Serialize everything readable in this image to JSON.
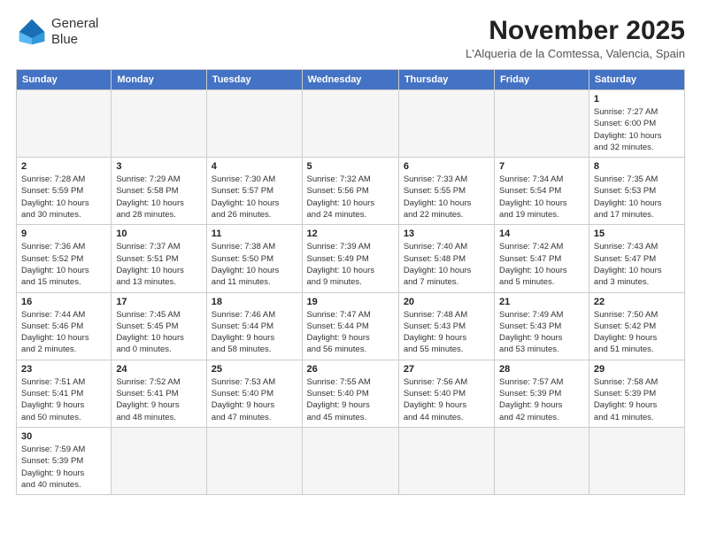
{
  "logo": {
    "line1": "General",
    "line2": "Blue"
  },
  "title": "November 2025",
  "location": "L'Alqueria de la Comtessa, Valencia, Spain",
  "weekdays": [
    "Sunday",
    "Monday",
    "Tuesday",
    "Wednesday",
    "Thursday",
    "Friday",
    "Saturday"
  ],
  "weeks": [
    [
      {
        "day": "",
        "info": ""
      },
      {
        "day": "",
        "info": ""
      },
      {
        "day": "",
        "info": ""
      },
      {
        "day": "",
        "info": ""
      },
      {
        "day": "",
        "info": ""
      },
      {
        "day": "",
        "info": ""
      },
      {
        "day": "1",
        "info": "Sunrise: 7:27 AM\nSunset: 6:00 PM\nDaylight: 10 hours\nand 32 minutes."
      }
    ],
    [
      {
        "day": "2",
        "info": "Sunrise: 7:28 AM\nSunset: 5:59 PM\nDaylight: 10 hours\nand 30 minutes."
      },
      {
        "day": "3",
        "info": "Sunrise: 7:29 AM\nSunset: 5:58 PM\nDaylight: 10 hours\nand 28 minutes."
      },
      {
        "day": "4",
        "info": "Sunrise: 7:30 AM\nSunset: 5:57 PM\nDaylight: 10 hours\nand 26 minutes."
      },
      {
        "day": "5",
        "info": "Sunrise: 7:32 AM\nSunset: 5:56 PM\nDaylight: 10 hours\nand 24 minutes."
      },
      {
        "day": "6",
        "info": "Sunrise: 7:33 AM\nSunset: 5:55 PM\nDaylight: 10 hours\nand 22 minutes."
      },
      {
        "day": "7",
        "info": "Sunrise: 7:34 AM\nSunset: 5:54 PM\nDaylight: 10 hours\nand 19 minutes."
      },
      {
        "day": "8",
        "info": "Sunrise: 7:35 AM\nSunset: 5:53 PM\nDaylight: 10 hours\nand 17 minutes."
      }
    ],
    [
      {
        "day": "9",
        "info": "Sunrise: 7:36 AM\nSunset: 5:52 PM\nDaylight: 10 hours\nand 15 minutes."
      },
      {
        "day": "10",
        "info": "Sunrise: 7:37 AM\nSunset: 5:51 PM\nDaylight: 10 hours\nand 13 minutes."
      },
      {
        "day": "11",
        "info": "Sunrise: 7:38 AM\nSunset: 5:50 PM\nDaylight: 10 hours\nand 11 minutes."
      },
      {
        "day": "12",
        "info": "Sunrise: 7:39 AM\nSunset: 5:49 PM\nDaylight: 10 hours\nand 9 minutes."
      },
      {
        "day": "13",
        "info": "Sunrise: 7:40 AM\nSunset: 5:48 PM\nDaylight: 10 hours\nand 7 minutes."
      },
      {
        "day": "14",
        "info": "Sunrise: 7:42 AM\nSunset: 5:47 PM\nDaylight: 10 hours\nand 5 minutes."
      },
      {
        "day": "15",
        "info": "Sunrise: 7:43 AM\nSunset: 5:47 PM\nDaylight: 10 hours\nand 3 minutes."
      }
    ],
    [
      {
        "day": "16",
        "info": "Sunrise: 7:44 AM\nSunset: 5:46 PM\nDaylight: 10 hours\nand 2 minutes."
      },
      {
        "day": "17",
        "info": "Sunrise: 7:45 AM\nSunset: 5:45 PM\nDaylight: 10 hours\nand 0 minutes."
      },
      {
        "day": "18",
        "info": "Sunrise: 7:46 AM\nSunset: 5:44 PM\nDaylight: 9 hours\nand 58 minutes."
      },
      {
        "day": "19",
        "info": "Sunrise: 7:47 AM\nSunset: 5:44 PM\nDaylight: 9 hours\nand 56 minutes."
      },
      {
        "day": "20",
        "info": "Sunrise: 7:48 AM\nSunset: 5:43 PM\nDaylight: 9 hours\nand 55 minutes."
      },
      {
        "day": "21",
        "info": "Sunrise: 7:49 AM\nSunset: 5:43 PM\nDaylight: 9 hours\nand 53 minutes."
      },
      {
        "day": "22",
        "info": "Sunrise: 7:50 AM\nSunset: 5:42 PM\nDaylight: 9 hours\nand 51 minutes."
      }
    ],
    [
      {
        "day": "23",
        "info": "Sunrise: 7:51 AM\nSunset: 5:41 PM\nDaylight: 9 hours\nand 50 minutes."
      },
      {
        "day": "24",
        "info": "Sunrise: 7:52 AM\nSunset: 5:41 PM\nDaylight: 9 hours\nand 48 minutes."
      },
      {
        "day": "25",
        "info": "Sunrise: 7:53 AM\nSunset: 5:40 PM\nDaylight: 9 hours\nand 47 minutes."
      },
      {
        "day": "26",
        "info": "Sunrise: 7:55 AM\nSunset: 5:40 PM\nDaylight: 9 hours\nand 45 minutes."
      },
      {
        "day": "27",
        "info": "Sunrise: 7:56 AM\nSunset: 5:40 PM\nDaylight: 9 hours\nand 44 minutes."
      },
      {
        "day": "28",
        "info": "Sunrise: 7:57 AM\nSunset: 5:39 PM\nDaylight: 9 hours\nand 42 minutes."
      },
      {
        "day": "29",
        "info": "Sunrise: 7:58 AM\nSunset: 5:39 PM\nDaylight: 9 hours\nand 41 minutes."
      }
    ],
    [
      {
        "day": "30",
        "info": "Sunrise: 7:59 AM\nSunset: 5:39 PM\nDaylight: 9 hours\nand 40 minutes."
      },
      {
        "day": "",
        "info": ""
      },
      {
        "day": "",
        "info": ""
      },
      {
        "day": "",
        "info": ""
      },
      {
        "day": "",
        "info": ""
      },
      {
        "day": "",
        "info": ""
      },
      {
        "day": "",
        "info": ""
      }
    ]
  ]
}
